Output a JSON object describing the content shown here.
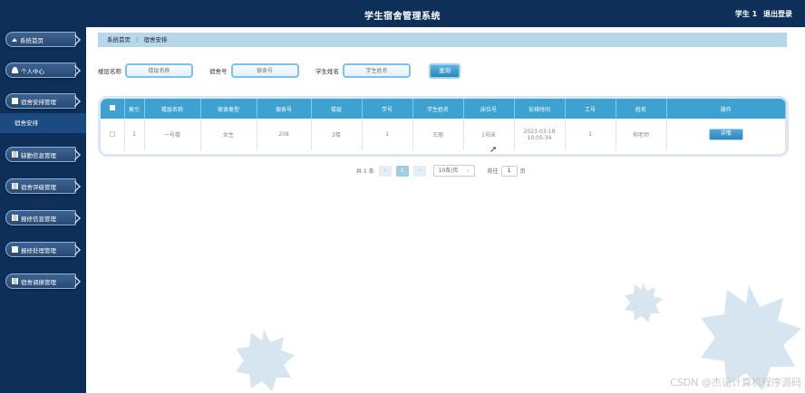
{
  "header": {
    "title": "学生宿舍管理系统",
    "user": "学生 1",
    "logout": "退出登录"
  },
  "sidebar": {
    "items": [
      {
        "label": "系统首页",
        "icon": "home-icon"
      },
      {
        "label": "个人中心",
        "icon": "user-icon"
      },
      {
        "label": "宿舍安排管理",
        "icon": "box-icon"
      },
      {
        "label": "缺勤信息管理",
        "icon": "grid-icon"
      },
      {
        "label": "宿舍评级管理",
        "icon": "grid-icon"
      },
      {
        "label": "报修信息管理",
        "icon": "grid-icon"
      },
      {
        "label": "报修处理管理",
        "icon": "box-icon"
      },
      {
        "label": "宿舍调换管理",
        "icon": "grid-icon"
      }
    ],
    "active_sub": "宿舍安排"
  },
  "breadcrumb": {
    "home": "系统首页",
    "sep": "⋮",
    "current": "宿舍安排"
  },
  "search": {
    "fields": [
      {
        "label": "楼层名称",
        "placeholder": "楼层名称"
      },
      {
        "label": "宿舍号",
        "placeholder": "宿舍号"
      },
      {
        "label": "学生姓名",
        "placeholder": "学生姓名"
      }
    ],
    "button": "查询"
  },
  "table": {
    "headers": [
      "索引",
      "楼层名称",
      "宿舍类型",
      "宿舍号",
      "楼层",
      "学号",
      "学生姓名",
      "床位号",
      "安排时间",
      "工号",
      "姓名",
      "操作"
    ],
    "rows": [
      {
        "cells": [
          "1",
          "一号楼",
          "女生",
          "208",
          "2楼",
          "1",
          "王丽",
          "1号床",
          "2023-03-18 10:05:34",
          "1",
          "何老师"
        ],
        "action": "详情"
      }
    ]
  },
  "pager": {
    "total": "共 1 条",
    "prev": "‹",
    "page": "1",
    "next": "›",
    "size": "10条/页",
    "goto": "前往",
    "goto_value": "1",
    "page_unit": "页"
  },
  "watermark": "CSDN @杰记计算机程序源码",
  "colors": {
    "navy": "#0d2f58",
    "header_blue": "#3da2d2",
    "crumb": "#b9d7ea"
  }
}
